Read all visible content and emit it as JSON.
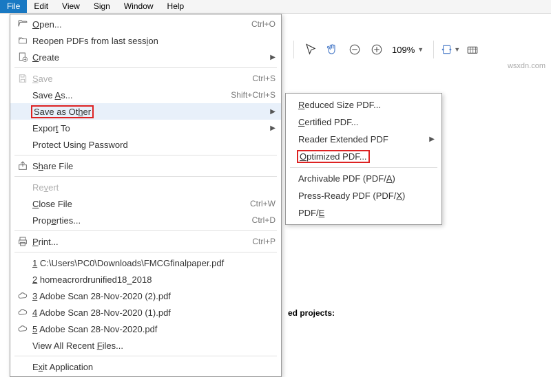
{
  "menubar": [
    "File",
    "Edit",
    "View",
    "Sign",
    "Window",
    "Help"
  ],
  "toolbar": {
    "zoom": "109%"
  },
  "file_menu": {
    "open": "Open...",
    "open_sc": "Ctrl+O",
    "reopen": "Reopen PDFs from last session",
    "create": "Create",
    "save": "Save",
    "save_sc": "Ctrl+S",
    "saveas": "Save As...",
    "saveas_sc": "Shift+Ctrl+S",
    "saveother": "Save as Other",
    "export": "Export To",
    "protect": "Protect Using Password",
    "share": "Share File",
    "revert": "Revert",
    "close": "Close File",
    "close_sc": "Ctrl+W",
    "props": "Properties...",
    "props_sc": "Ctrl+D",
    "print": "Print...",
    "print_sc": "Ctrl+P",
    "r1": "1 C:\\Users\\PC0\\Downloads\\FMCGfinalpaper.pdf",
    "r2": "2 homeacrordrunified18_2018",
    "r3": "3 Adobe Scan 28-Nov-2020 (2).pdf",
    "r4": "4 Adobe Scan 28-Nov-2020 (1).pdf",
    "r5": "5 Adobe Scan 28-Nov-2020.pdf",
    "viewall": "View All Recent Files...",
    "exit": "Exit Application"
  },
  "submenu": {
    "reduced": "Reduced Size PDF...",
    "certified": "Certified PDF...",
    "reader": "Reader Extended PDF",
    "optimized": "Optimized PDF...",
    "archivable": "Archivable PDF (PDF/A)",
    "press": "Press-Ready PDF (PDF/X)",
    "pdfe": "PDF/E"
  },
  "bg": {
    "projects": "ed projects:"
  },
  "watermark": "wsxdn.com"
}
